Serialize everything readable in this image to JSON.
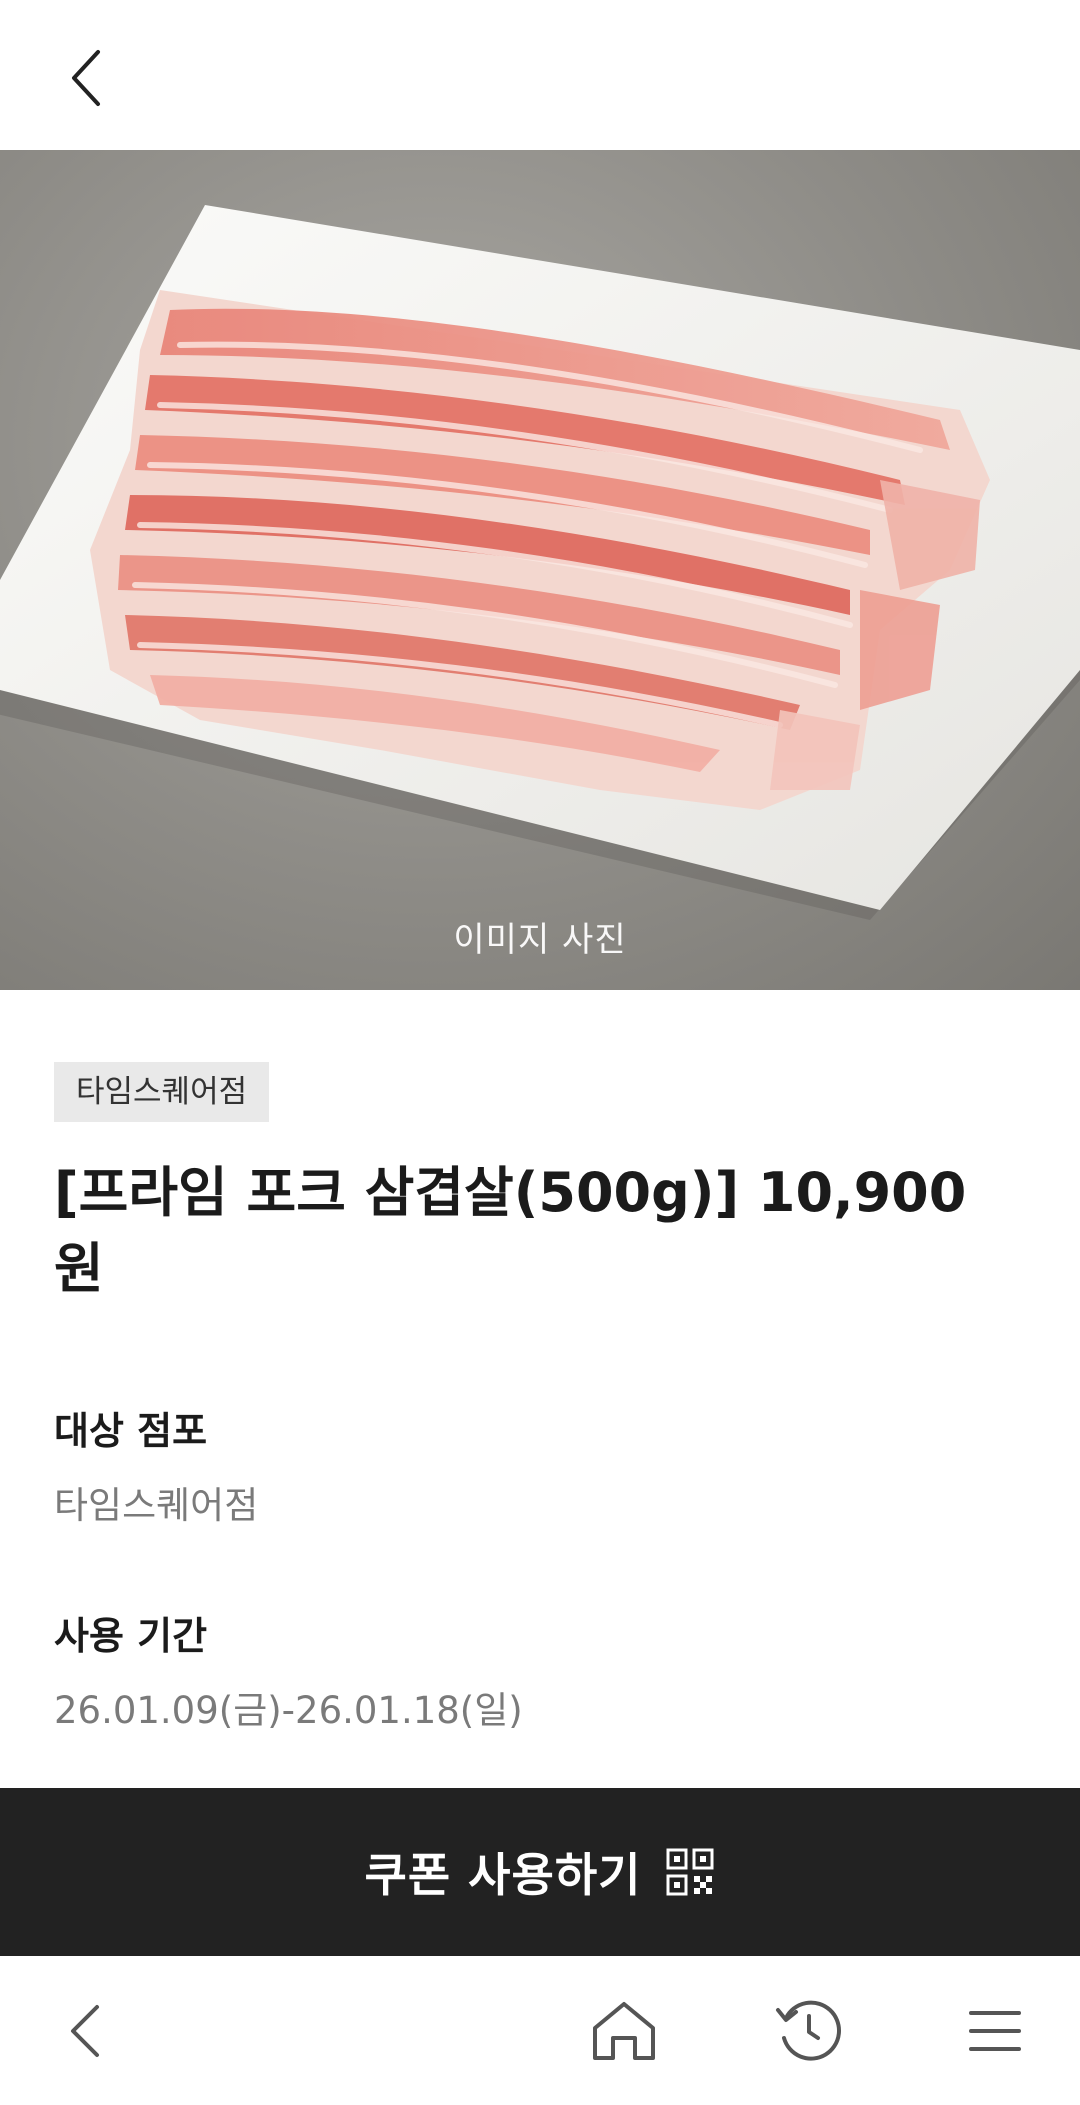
{
  "header": {
    "back_icon": "chevron-left-icon"
  },
  "hero": {
    "caption": "이미지 사진"
  },
  "product": {
    "store_badge": "타임스퀘어점",
    "title": "[프라임 포크 삼겹살(500g)] 10,900원"
  },
  "info": {
    "store_label": "대상 점포",
    "store_value": "타임스퀘어점",
    "period_label": "사용 기간",
    "period_value": "26.01.09(금)-26.01.18(일)"
  },
  "cta": {
    "label": "쿠폰 사용하기",
    "icon": "qr-code-icon"
  },
  "bottom_nav": {
    "items": [
      "back-icon",
      "home-icon",
      "history-icon",
      "menu-icon"
    ]
  },
  "colors": {
    "cta_bg": "#222222",
    "badge_bg": "#e9e9e9",
    "muted_text": "#7a7a7a"
  }
}
